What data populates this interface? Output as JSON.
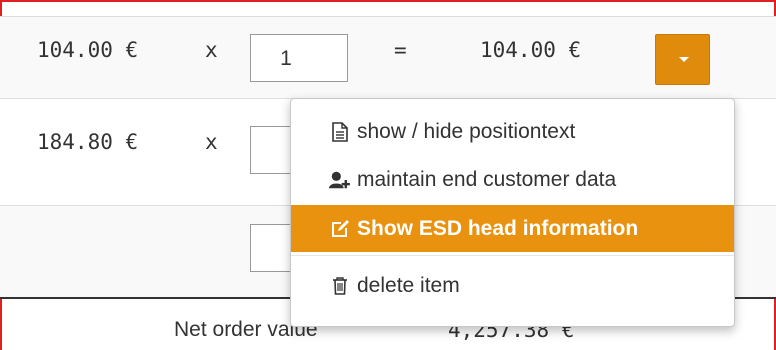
{
  "row1": {
    "unit_price": "104.00 €",
    "times": "x",
    "quantity": "1",
    "equals": "=",
    "line_total": "104.00 €"
  },
  "row2": {
    "unit_price": "184.80 €",
    "times": "x"
  },
  "footer": {
    "net_label": "Net order value",
    "net_value": "4,257.38 €"
  },
  "menu": {
    "items": [
      {
        "label": "show / hide positiontext",
        "icon": "document-icon"
      },
      {
        "label": "maintain end customer data",
        "icon": "add-user-icon"
      },
      {
        "label": "Show ESD head information",
        "icon": "edit-icon"
      },
      {
        "label": "delete item",
        "icon": "trash-icon"
      }
    ]
  },
  "colors": {
    "accent": "#e08b0c",
    "highlight": "#e8920f",
    "frame": "#e02020"
  }
}
